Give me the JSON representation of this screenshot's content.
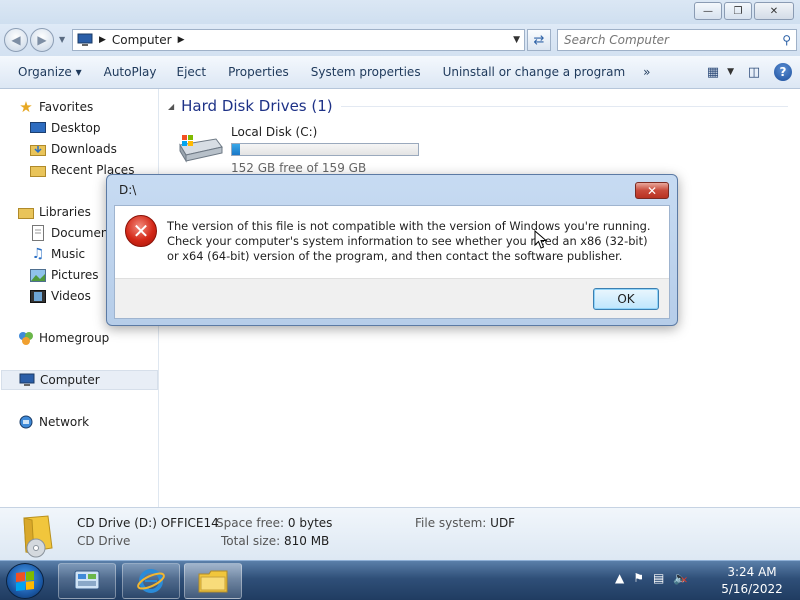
{
  "window": {
    "buttons": {
      "minimize": "—",
      "restore": "❐",
      "close": "✕"
    }
  },
  "nav": {
    "back_icon": "back-arrow-icon",
    "forward_icon": "forward-arrow-icon",
    "address_path": "Computer",
    "search_placeholder": "Search Computer"
  },
  "toolbar": {
    "items": [
      "Organize ▾",
      "AutoPlay",
      "Eject",
      "Properties",
      "System properties",
      "Uninstall or change a program",
      "»"
    ]
  },
  "sidebar": {
    "favorites": {
      "label": "Favorites",
      "items": [
        "Desktop",
        "Downloads",
        "Recent Places"
      ]
    },
    "libraries": {
      "label": "Libraries",
      "items": [
        "Documents",
        "Music",
        "Pictures",
        "Videos"
      ]
    },
    "homegroup": "Homegroup",
    "computer": "Computer",
    "network": "Network"
  },
  "content": {
    "group_title": "Hard Disk Drives (1)",
    "drive": {
      "name": "Local Disk (C:)",
      "free_text": "152 GB free of 159 GB",
      "used_fraction": 0.044
    }
  },
  "details": {
    "name": "CD Drive (D:) OFFICE14",
    "type": "CD Drive",
    "space_free_label": "Space free:",
    "space_free_value": "0 bytes",
    "total_size_label": "Total size:",
    "total_size_value": "810 MB",
    "fs_label": "File system:",
    "fs_value": "UDF"
  },
  "taskbar": {
    "time": "3:24 AM",
    "date": "5/16/2022"
  },
  "dialog": {
    "title": "D:\\",
    "close": "✕",
    "message": "The version of this file is not compatible with the version of Windows you're running. Check your computer's system information to see whether you need an x86 (32-bit) or x64 (64-bit) version of the program, and then contact the software publisher.",
    "ok": "OK"
  },
  "colors": {
    "accent_blue": "#1e3287",
    "error_red": "#d32717",
    "progress_blue": "#1b78c7"
  }
}
